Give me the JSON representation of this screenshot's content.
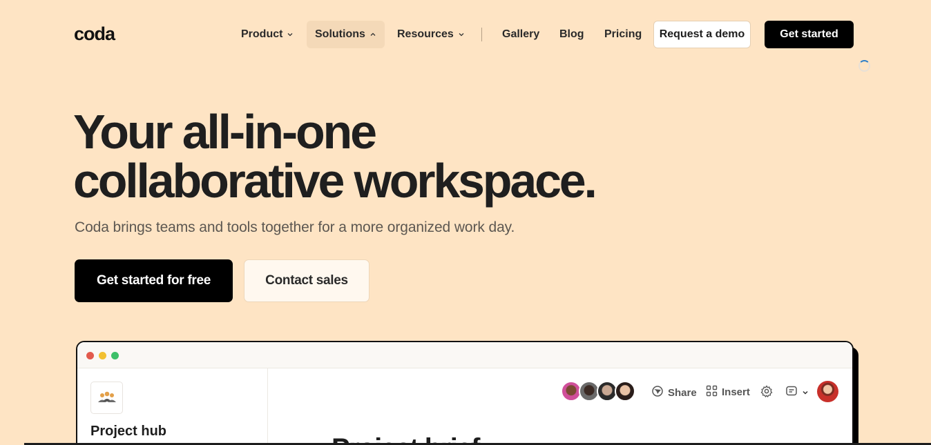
{
  "nav": {
    "logo": "coda",
    "items": [
      {
        "label": "Product"
      },
      {
        "label": "Solutions"
      },
      {
        "label": "Resources"
      },
      {
        "label": "Gallery"
      },
      {
        "label": "Blog"
      },
      {
        "label": "Pricing"
      }
    ],
    "request_demo": "Request a demo",
    "get_started": "Get started"
  },
  "hero": {
    "title_line1": "Your all-in-one",
    "title_line2": "collaborative workspace.",
    "subtitle": "Coda brings teams and tools together for a more organized work day.",
    "cta_primary": "Get started for free",
    "cta_secondary": "Contact sales"
  },
  "app_window": {
    "window_dots": [
      "#e25a4d",
      "#f2c031",
      "#3ec06a"
    ],
    "sidebar": {
      "title": "Project hub",
      "icon": "people-group-icon"
    },
    "toolbar": {
      "share": "Share",
      "insert": "Insert"
    },
    "doc_title": "Project brief"
  },
  "colors": {
    "background": "#fee4c4",
    "primary_button": "#000000",
    "accent_blue": "#2d7fc9"
  }
}
